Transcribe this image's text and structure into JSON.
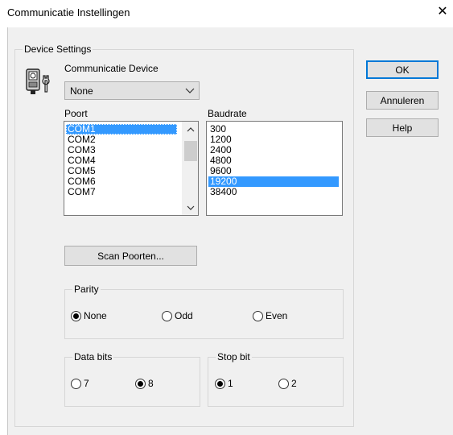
{
  "window": {
    "title": "Communicatie Instellingen",
    "close_glyph": "✕"
  },
  "device_group": {
    "label": "Device Settings",
    "device_label": "Communicatie Device",
    "device_value": "None",
    "icon": "device-wrench-icon"
  },
  "buttons": {
    "ok": "OK",
    "cancel": "Annuleren",
    "help": "Help",
    "scan": "Scan Poorten..."
  },
  "port": {
    "label": "Poort",
    "items": [
      "COM1",
      "COM2",
      "COM3",
      "COM4",
      "COM5",
      "COM6",
      "COM7"
    ],
    "selected": "COM1"
  },
  "baud": {
    "label": "Baudrate",
    "items": [
      "300",
      "1200",
      "2400",
      "4800",
      "9600",
      "19200",
      "38400"
    ],
    "selected": "19200"
  },
  "parity": {
    "label": "Parity",
    "options": [
      "None",
      "Odd",
      "Even"
    ],
    "selected": "None"
  },
  "data_bits": {
    "label": "Data bits",
    "options": [
      "7",
      "8"
    ],
    "selected": "8"
  },
  "stop_bit": {
    "label": "Stop bit",
    "options": [
      "1",
      "2"
    ],
    "selected": "1"
  },
  "colors": {
    "selection": "#3399ff",
    "dialog_bg": "#f0f0f0",
    "default_border": "#0078d7"
  }
}
